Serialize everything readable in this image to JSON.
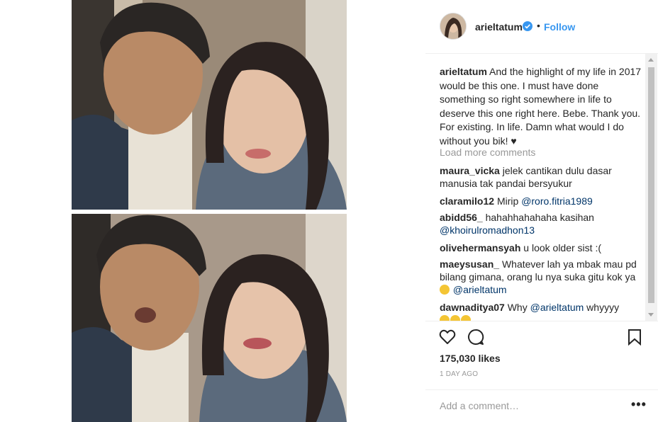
{
  "post": {
    "username": "arieltatum",
    "follow_label": "Follow",
    "separator": "•",
    "caption_username": "arieltatum",
    "caption_text": "And the highlight of my life in 2017 would be this one. I must have done something so right somewhere in life to deserve this one right here. Bebe. Thank you. For existing. In life. Damn what would I do without you bik! ♥",
    "load_more_label": "Load more comments",
    "likes": "175,030 likes",
    "time": "1 DAY AGO",
    "add_comment_placeholder": "Add a comment…",
    "more_label": "•••"
  },
  "comments": [
    {
      "user": "maura_vicka",
      "text": "jelek cantikan dulu dasar manusia tak pandai bersyukur",
      "mention": "",
      "after": ""
    },
    {
      "user": "claramilo12",
      "text": "Mirip ",
      "mention": "@roro.fitria1989",
      "after": ""
    },
    {
      "user": "abidd56_",
      "text": "hahahhahahaha kasihan ",
      "mention": "@khoirulromadhon13",
      "after": ""
    },
    {
      "user": "olivehermansyah",
      "text": "u look older sist :(",
      "mention": "",
      "after": ""
    },
    {
      "user": "maeysusan_",
      "text": "Whatever lah ya mbak mau pd bilang gimana, orang lu nya suka gitu kok ya ",
      "mention": "@arieltatum",
      "after": ""
    },
    {
      "user": "dawnaditya07",
      "text": "Why ",
      "mention": "@arieltatum",
      "after": " whyyyy"
    }
  ],
  "icons": {
    "verified": "verified-badge-icon",
    "like": "heart-icon",
    "comment": "comment-bubble-icon",
    "save": "bookmark-icon"
  },
  "colors": {
    "link_blue": "#3897f0",
    "mention_blue": "#003569",
    "muted": "#999999",
    "text": "#262626"
  }
}
